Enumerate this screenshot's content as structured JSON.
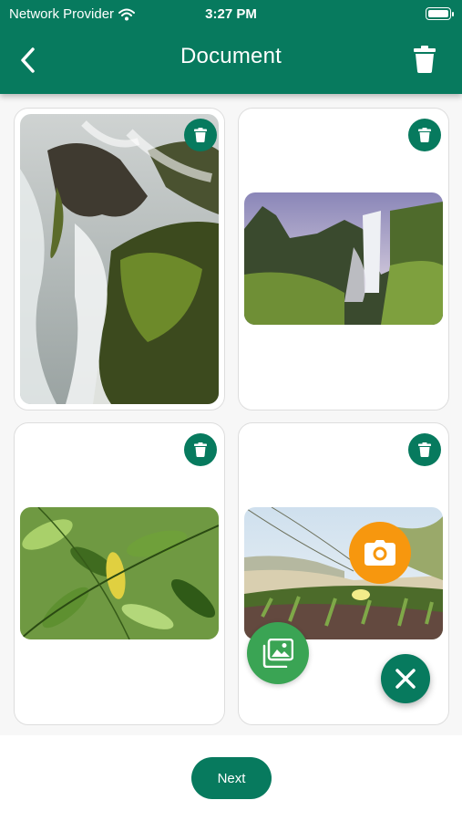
{
  "status_bar": {
    "carrier": "Network Provider",
    "time": "3:27 PM"
  },
  "header": {
    "title": "Document"
  },
  "documents": [
    {
      "scene": "waterfall-closeup"
    },
    {
      "scene": "waterfall-valley"
    },
    {
      "scene": "green-leaves"
    },
    {
      "scene": "beach-dunes-flowers"
    }
  ],
  "footer": {
    "next_label": "Next"
  },
  "fab_menu": {
    "camera_icon": "camera-icon",
    "gallery_icon": "gallery-icon",
    "close_icon": "close-icon"
  },
  "colors": {
    "primary": "#077a5e",
    "camera_fab": "#f7970e",
    "gallery_fab": "#3aa454"
  }
}
